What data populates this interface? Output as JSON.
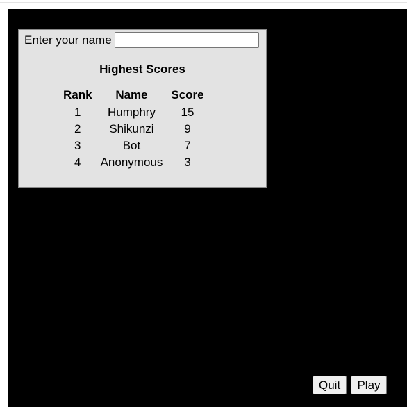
{
  "name_entry": {
    "label": "Enter your name",
    "value": "",
    "placeholder": ""
  },
  "leaderboard": {
    "title": "Highest Scores",
    "columns": [
      "Rank",
      "Name",
      "Score"
    ],
    "rows": [
      {
        "rank": "1",
        "name": "Humphry",
        "score": "15"
      },
      {
        "rank": "2",
        "name": "Shikunzi",
        "score": "9"
      },
      {
        "rank": "3",
        "name": "Bot",
        "score": "7"
      },
      {
        "rank": "4",
        "name": "Anonymous",
        "score": "3"
      }
    ]
  },
  "controls": {
    "quit_label": "Quit",
    "play_label": "Play"
  },
  "colors": {
    "canvas_background": "#000000",
    "panel_background": "#e3e3e3",
    "button_background": "#efefef"
  }
}
